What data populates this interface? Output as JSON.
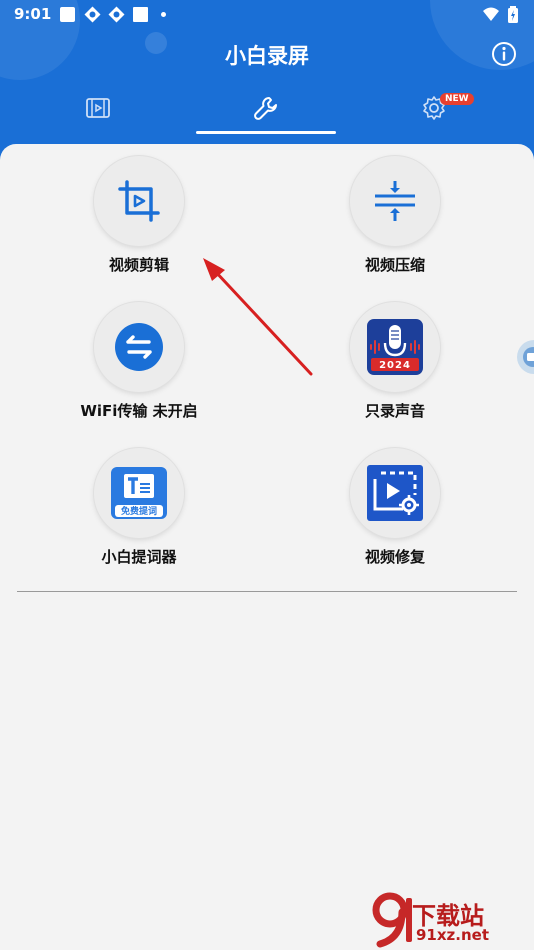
{
  "status_bar": {
    "time": "9:01",
    "icons": [
      "square-icon",
      "shield-icon",
      "shield-icon",
      "square-icon",
      "dot-icon",
      "wifi-icon",
      "battery-icon"
    ]
  },
  "app": {
    "title": "小白录屏"
  },
  "tabs": [
    {
      "name": "video-list",
      "icon": "film-icon",
      "active": false
    },
    {
      "name": "tools",
      "icon": "wrench-icon",
      "active": true
    },
    {
      "name": "settings",
      "icon": "gear-icon",
      "active": false,
      "badge": "NEW"
    }
  ],
  "tools": [
    {
      "label": "视频剪辑",
      "icon": "crop-play-icon"
    },
    {
      "label": "视频压缩",
      "icon": "compress-icon"
    },
    {
      "label": "WiFi传输 未开启",
      "icon": "transfer-icon"
    },
    {
      "label": "只录声音",
      "icon": "microphone-icon",
      "badge_text": "2024"
    },
    {
      "label": "小白提词器",
      "icon": "teleprompter-icon",
      "badge_text": "免费提词"
    },
    {
      "label": "视频修复",
      "icon": "video-repair-icon"
    }
  ],
  "watermark": {
    "text": "下载站",
    "url": "91xz.net"
  },
  "colors": {
    "primary": "#1a6fd6",
    "accent_red": "#e8402f",
    "mic_bg": "#1d3f9a",
    "repair_bg": "#1e56c8"
  }
}
